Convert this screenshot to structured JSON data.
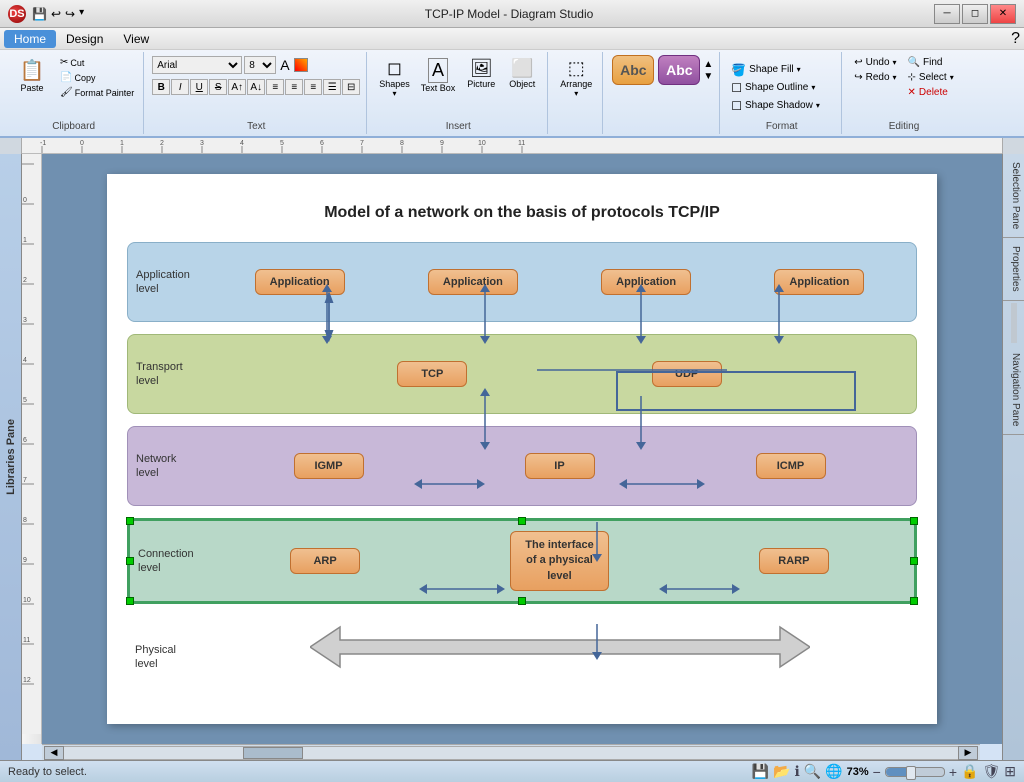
{
  "window": {
    "title": "TCP-IP Model - Diagram Studio",
    "icon": "DS"
  },
  "menu": {
    "items": [
      "Home",
      "Design",
      "View"
    ]
  },
  "ribbon": {
    "groups": [
      {
        "label": "Clipboard",
        "buttons": [
          {
            "id": "paste",
            "label": "Paste",
            "icon": "📋"
          },
          {
            "id": "cut",
            "label": "",
            "icon": "✂"
          },
          {
            "id": "copy",
            "label": "",
            "icon": "📄"
          },
          {
            "id": "format-painter",
            "label": "",
            "icon": "🖌"
          }
        ]
      },
      {
        "label": "Text",
        "font": "Arial",
        "size": "8",
        "bold": "B",
        "italic": "I",
        "underline": "U"
      },
      {
        "label": "Insert",
        "buttons": [
          {
            "id": "shapes",
            "label": "Shapes",
            "icon": "◻"
          },
          {
            "id": "textbox",
            "label": "Text Box",
            "icon": "A"
          },
          {
            "id": "picture",
            "label": "Picture",
            "icon": "🖼"
          },
          {
            "id": "object",
            "label": "Object",
            "icon": "⬜"
          }
        ]
      },
      {
        "label": "",
        "buttons": [
          {
            "id": "arrange",
            "label": "Arrange",
            "icon": "⬚"
          }
        ]
      },
      {
        "label": "Format",
        "shape_fill": "Shape Fill",
        "shape_outline": "Shape Outline",
        "shape_shadow": "Shape Shadow"
      },
      {
        "label": "Editing",
        "undo": "Undo",
        "redo": "Redo",
        "find": "Find",
        "select": "Select",
        "delete": "Delete"
      }
    ]
  },
  "diagram": {
    "title": "Model of a network on the basis of protocols TCP/IP",
    "layers": [
      {
        "id": "application",
        "label": "Application\nlevel",
        "color": "#b8d4e8",
        "nodes": [
          "Application",
          "Application",
          "Application",
          "Application"
        ]
      },
      {
        "id": "transport",
        "label": "Transport\nlevel",
        "color": "#c8d8a0",
        "nodes": [
          "TCP",
          "UDP"
        ]
      },
      {
        "id": "network",
        "label": "Network\nlevel",
        "color": "#c8b8d8",
        "nodes": [
          "IGMP",
          "IP",
          "ICMP"
        ]
      },
      {
        "id": "connection",
        "label": "Connection\nlevel",
        "color": "#b8d8c8",
        "nodes": [
          "ARP",
          "The interface\nof a physical\nlevel",
          "RARP"
        ]
      },
      {
        "id": "physical",
        "label": "Physical\nlevel",
        "color": "transparent",
        "nodes": []
      }
    ]
  },
  "sidebar": {
    "left_label": "Libraries Pane",
    "right_tabs": [
      "Selection Pane",
      "Properties",
      "Navigation Pane"
    ]
  },
  "status": {
    "text": "Ready to select.",
    "zoom": "73%"
  },
  "scrollbar": {
    "h_label": ""
  }
}
